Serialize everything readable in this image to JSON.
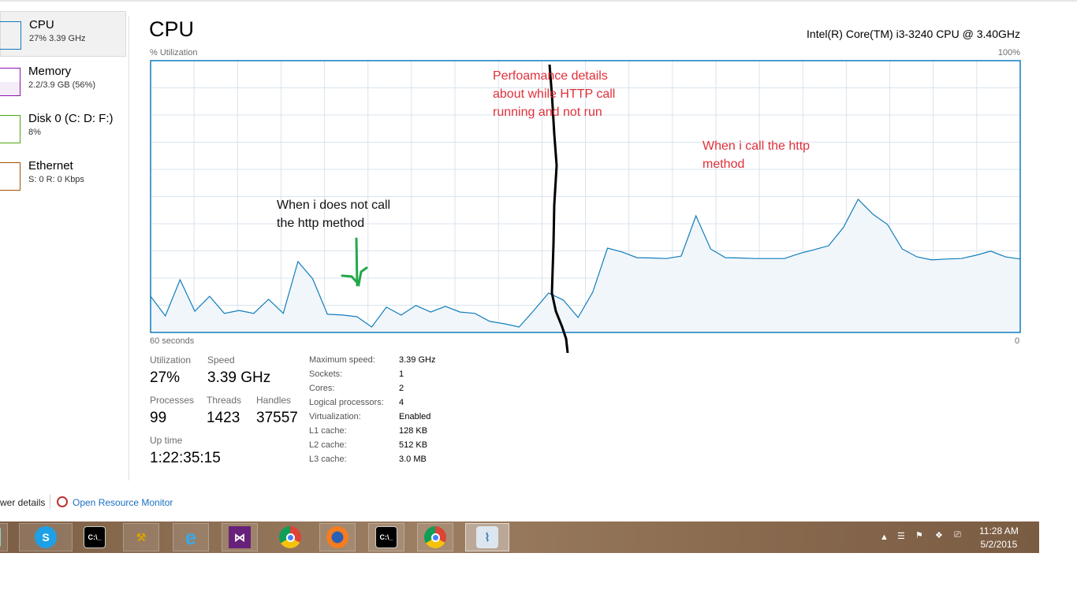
{
  "sidebar": {
    "items": [
      {
        "title": "CPU",
        "sub": "27% 3.39 GHz",
        "color": "#117dbb"
      },
      {
        "title": "Memory",
        "sub": "2.2/3.9 GB (56%)",
        "color": "#8b12ae"
      },
      {
        "title": "Disk 0 (C: D: F:)",
        "sub": "8%",
        "color": "#4da60c"
      },
      {
        "title": "Ethernet",
        "sub": "S: 0 R: 0 Kbps",
        "color": "#a74f01"
      }
    ]
  },
  "header": {
    "title": "CPU",
    "processor": "Intel(R) Core(TM) i3-3240 CPU @ 3.40GHz"
  },
  "chart_data": {
    "type": "area",
    "ylabel": "% Utilization",
    "ylim": [
      0,
      100
    ],
    "y_max_label": "100%",
    "x_left_label": "60 seconds",
    "x_right_label": "0",
    "grid": true,
    "color": "#117dbb",
    "values": [
      13.3,
      6.1,
      19.4,
      7.8,
      13.3,
      7.0,
      8.1,
      7.0,
      12.2,
      7.0,
      26.1,
      19.7,
      6.7,
      6.4,
      5.8,
      2.0,
      9.3,
      6.4,
      9.9,
      7.5,
      9.6,
      7.5,
      7.0,
      4.1,
      3.2,
      2.0,
      8.1,
      14.5,
      11.9,
      5.5,
      14.8,
      31.0,
      29.6,
      27.5,
      27.4,
      27.2,
      28.1,
      42.9,
      30.7,
      27.5,
      27.4,
      27.2,
      27.2,
      27.2,
      29.0,
      30.4,
      31.9,
      38.6,
      49.0,
      43.5,
      39.7,
      30.7,
      27.8,
      26.7,
      27.0,
      27.2,
      28.4,
      29.9,
      27.8,
      27.0
    ]
  },
  "annotations": {
    "center": "Perfoamance details about while HTTP call running and not run",
    "center_lines": [
      "Perfoamance details",
      "about while HTTP call",
      "running and not run"
    ],
    "right_lines": [
      "When i call the http",
      "method"
    ],
    "left_lines": [
      "When i does not call",
      "the http method"
    ]
  },
  "stats": {
    "utilization_label": "Utilization",
    "utilization": "27%",
    "speed_label": "Speed",
    "speed": "3.39 GHz",
    "processes_label": "Processes",
    "processes": "99",
    "threads_label": "Threads",
    "threads": "1423",
    "handles_label": "Handles",
    "handles": "37557",
    "uptime_label": "Up time",
    "uptime": "1:22:35:15"
  },
  "specs": [
    {
      "k": "Maximum speed:",
      "v": "3.39 GHz"
    },
    {
      "k": "Sockets:",
      "v": "1"
    },
    {
      "k": "Cores:",
      "v": "2"
    },
    {
      "k": "Logical processors:",
      "v": "4"
    },
    {
      "k": "Virtualization:",
      "v": "Enabled"
    },
    {
      "k": "L1 cache:",
      "v": "128 KB"
    },
    {
      "k": "L2 cache:",
      "v": "512 KB"
    },
    {
      "k": "L3 cache:",
      "v": "3.0 MB"
    }
  ],
  "footer": {
    "fewer_details": "wer details",
    "resource_monitor": "Open Resource Monitor"
  },
  "taskbar": {
    "apps": [
      "calculator",
      "skype",
      "command-prompt",
      "database-tools",
      "internet-explorer",
      "visual-studio",
      "chrome",
      "firefox",
      "command-prompt",
      "chrome",
      "task-manager"
    ],
    "clock_time": "11:28 AM",
    "clock_date": "5/2/2015"
  }
}
